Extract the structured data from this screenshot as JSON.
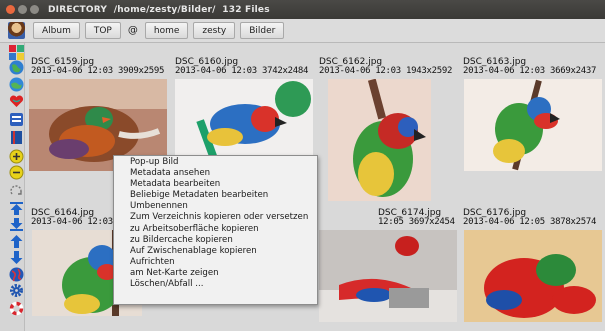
{
  "window": {
    "title": "DIRECTORY  /home/zesty/Bilder/  132 Files"
  },
  "toolbar": {
    "buttons": [
      "Album",
      "TOP"
    ],
    "at_symbol": "@",
    "path_buttons": [
      "home",
      "zesty",
      "Bilder"
    ]
  },
  "sidebar": {
    "icons": [
      "hand-pointer-icon",
      "collage-icon",
      "globe-icon",
      "globe-arrow-icon",
      "heart-icon",
      "window-icon",
      "book-icon",
      "zoom-in-icon",
      "zoom-out-icon",
      "rotate-icon",
      "skip-top-icon",
      "skip-bottom-icon",
      "arrow-up-icon",
      "arrow-down-icon",
      "world-icon",
      "gear-icon",
      "lifebuoy-icon"
    ]
  },
  "files": [
    {
      "name": "DSC_6159.jpg",
      "meta": "2013-04-06 12:03  3909x2595"
    },
    {
      "name": "DSC_6160.jpg",
      "meta": "2013-04-06 12:03  3742x2484"
    },
    {
      "name": "DSC_6162.jpg",
      "meta": "2013-04-06 12:03  1943x2592"
    },
    {
      "name": "DSC_6163.jpg",
      "meta": "2013-04-06 12:03  3669x2437"
    },
    {
      "name": "DSC_6164.jpg",
      "meta": "2013-04-06 12:03"
    },
    {
      "name": "DSC_6174.jpg",
      "meta": "12:05  3697x2454"
    },
    {
      "name": "DSC_6176.jpg",
      "meta": "2013-04-06 12:05  3878x2574"
    }
  ],
  "context_menu": {
    "items": [
      "Pop-up Bild",
      "Metadata ansehen",
      "Metadata bearbeiten",
      "Beliebige Metadaten bearbeiten",
      "Umbenennen",
      "Zum Verzeichnis kopieren oder versetzen",
      "zu Arbeitsoberfläche kopieren",
      "zu Bildercache kopieren",
      "Auf Zwischenablage kopieren",
      "Aufrichten",
      "am Net-Karte zeigen",
      "Löschen/Abfall ..."
    ]
  },
  "colors": {
    "titlebar": "#3c3b37",
    "window_bg": "#d9d9d9",
    "menu_bg": "#f1f1f1",
    "close_button": "#e9683e"
  }
}
